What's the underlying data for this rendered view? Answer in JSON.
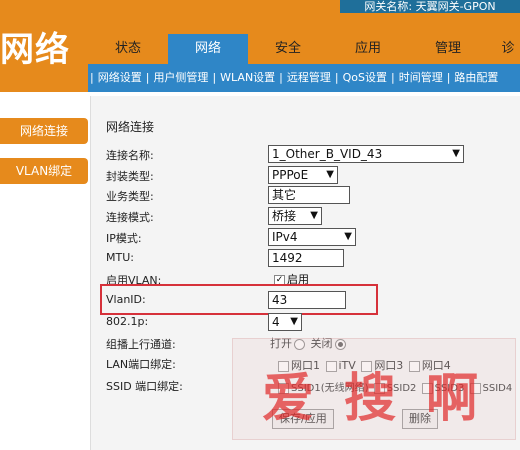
{
  "header": {
    "logo_text": "网络",
    "gateway_name": "网关名称: 天翼网关-GPON",
    "tabs": [
      "状态",
      "网络",
      "安全",
      "应用",
      "管理",
      "诊"
    ],
    "active_tab_index": 1,
    "subnav": [
      "网络设置",
      "用户侧管理",
      "WLAN设置",
      "远程管理",
      "QoS设置",
      "时间管理",
      "路由配置"
    ]
  },
  "sidebar": {
    "items": [
      "网络连接",
      "VLAN绑定"
    ]
  },
  "content": {
    "title": "网络连接",
    "labels": {
      "conn_name": "连接名称:",
      "encap": "封装类型:",
      "service": "业务类型:",
      "conn_mode": "连接模式:",
      "ip_mode": "IP模式:",
      "mtu": "MTU:",
      "enable_vlan": "启用VLAN:",
      "vlan_id": "VlanID:",
      "dot1p": "802.1p:",
      "multicast": "组播上行通道:",
      "lan_bind": "LAN端口绑定:",
      "ssid_bind": "SSID 端口绑定:"
    },
    "values": {
      "conn_name": "1_Other_B_VID_43",
      "encap": "PPPoE",
      "service": "其它",
      "conn_mode": "桥接",
      "ip_mode": "IPv4",
      "mtu": "1492",
      "enable_vlan_label": "启用",
      "vlan_id": "43",
      "dot1p": "4"
    },
    "multicast_options": {
      "on": "打开",
      "off": "关闭"
    },
    "lan_ports": [
      "网口1",
      "iTV",
      "网口3",
      "网口4"
    ],
    "ssid_ports": [
      "SSID1(无线网络)",
      "SSID2",
      "SSID3",
      "SSID4"
    ],
    "buttons": {
      "save": "保存/应用",
      "delete": "删除"
    }
  },
  "watermark": "爱搜啊",
  "colors": {
    "orange": "#e68a1c",
    "blue": "#2f86c7",
    "highlight_red": "#d6313a"
  }
}
